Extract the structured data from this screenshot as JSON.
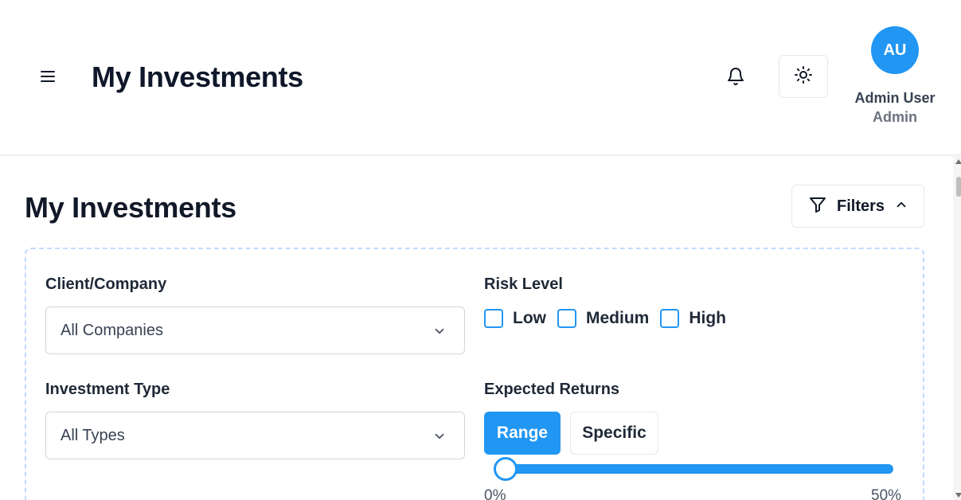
{
  "header": {
    "title": "My Investments",
    "menu_icon": "hamburger-menu-icon",
    "notification_icon": "bell-icon",
    "theme_icon": "sun-icon",
    "user": {
      "initials": "AU",
      "name": "Admin User",
      "role": "Admin"
    }
  },
  "main": {
    "title": "My Investments",
    "filters_button": {
      "label": "Filters",
      "icon": "filter-icon",
      "state_icon": "chevron-up-icon"
    },
    "filters": {
      "client": {
        "label": "Client/Company",
        "selected": "All Companies"
      },
      "investment_type": {
        "label": "Investment Type",
        "selected": "All Types"
      },
      "risk_level": {
        "label": "Risk Level",
        "options": [
          "Low",
          "Medium",
          "High"
        ],
        "checked": [
          false,
          false,
          false
        ]
      },
      "expected_returns": {
        "label": "Expected Returns",
        "modes": [
          "Range",
          "Specific"
        ],
        "active_mode": "Range",
        "min_label": "0%",
        "max_label": "50%",
        "range_min": 0,
        "range_max": 50
      }
    }
  },
  "colors": {
    "accent": "#2196f3",
    "panel_border": "#bfdbfe"
  }
}
